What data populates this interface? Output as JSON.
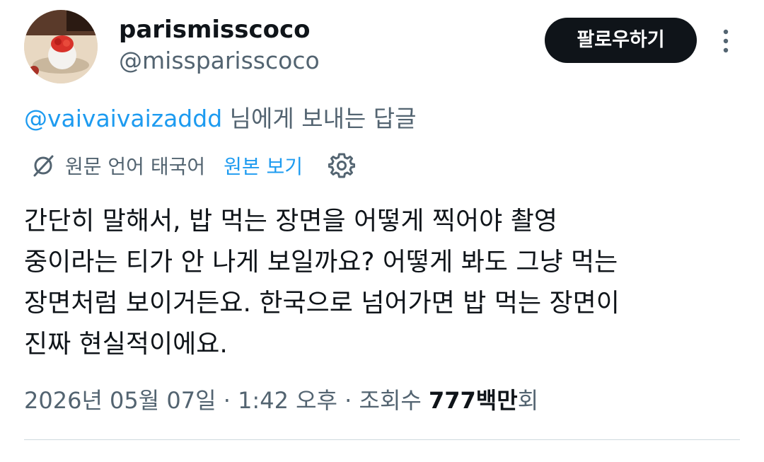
{
  "author": {
    "display_name": "parismisscoco",
    "handle": "@missparisscoco"
  },
  "header": {
    "follow_label": "팔로우하기"
  },
  "reply": {
    "mention": "@vaivaivaizaddd",
    "suffix": " 님에게 보내는 답글"
  },
  "translation": {
    "source_language": "원문 언어 태국어",
    "show_original_label": "원본 보기"
  },
  "tweet": {
    "line1": "간단히 말해서, 밥 먹는 장면을 어떻게 찍어야 촬영",
    "line2": "중이라는 티가 안 나게 보일까요? 어떻게 봐도 그냥 먹는",
    "line3": "장면처럼 보이거든요. 한국으로 넘어가면 밥 먹는 장면이",
    "line4": "진짜 현실적이에요."
  },
  "meta": {
    "date": "2026년 05월 07일",
    "separator": " · ",
    "time": "1:42 오후",
    "views_label": "조회수 ",
    "views_count": "777백만",
    "views_suffix": "회"
  },
  "colors": {
    "accent": "#1d9bf0",
    "text_primary": "#0f1419",
    "text_secondary": "#536471",
    "follow_button_bg": "#0f1419"
  },
  "icons": {
    "avatar": "avatar-photo",
    "more": "more-vertical-icon",
    "translate": "globe-slash-icon",
    "settings": "gear-icon"
  }
}
